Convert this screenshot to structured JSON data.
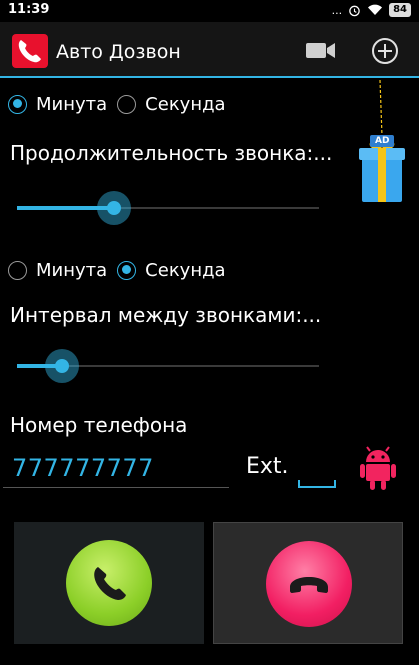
{
  "status_bar": {
    "time": "11:39",
    "more": "...",
    "battery": "84",
    "icons": [
      "alarm-icon",
      "wifi-icon",
      "battery-icon"
    ]
  },
  "app_bar": {
    "title": "Авто Дозвон",
    "logo_icon": "phone-logo-icon",
    "actions": [
      "video-camera-icon",
      "add-circle-icon"
    ],
    "accent_color": "#33b5e5"
  },
  "duration": {
    "options": [
      {
        "label": "Минута",
        "checked": true
      },
      {
        "label": "Секунда",
        "checked": false
      }
    ],
    "heading": "Продолжительность звонка:...",
    "slider_value": 0.32
  },
  "interval": {
    "options": [
      {
        "label": "Минута",
        "checked": false
      },
      {
        "label": "Секунда",
        "checked": true
      }
    ],
    "heading": "Интервал между звонками:...",
    "slider_value": 0.15
  },
  "phone": {
    "label": "Номер телефона",
    "value": "777777777",
    "ext_label": "Ext.",
    "ext_value": ""
  },
  "ad": {
    "badge": "AD"
  },
  "call_buttons": {
    "start_color": "#8ccf28",
    "end_color": "#f21f63"
  }
}
